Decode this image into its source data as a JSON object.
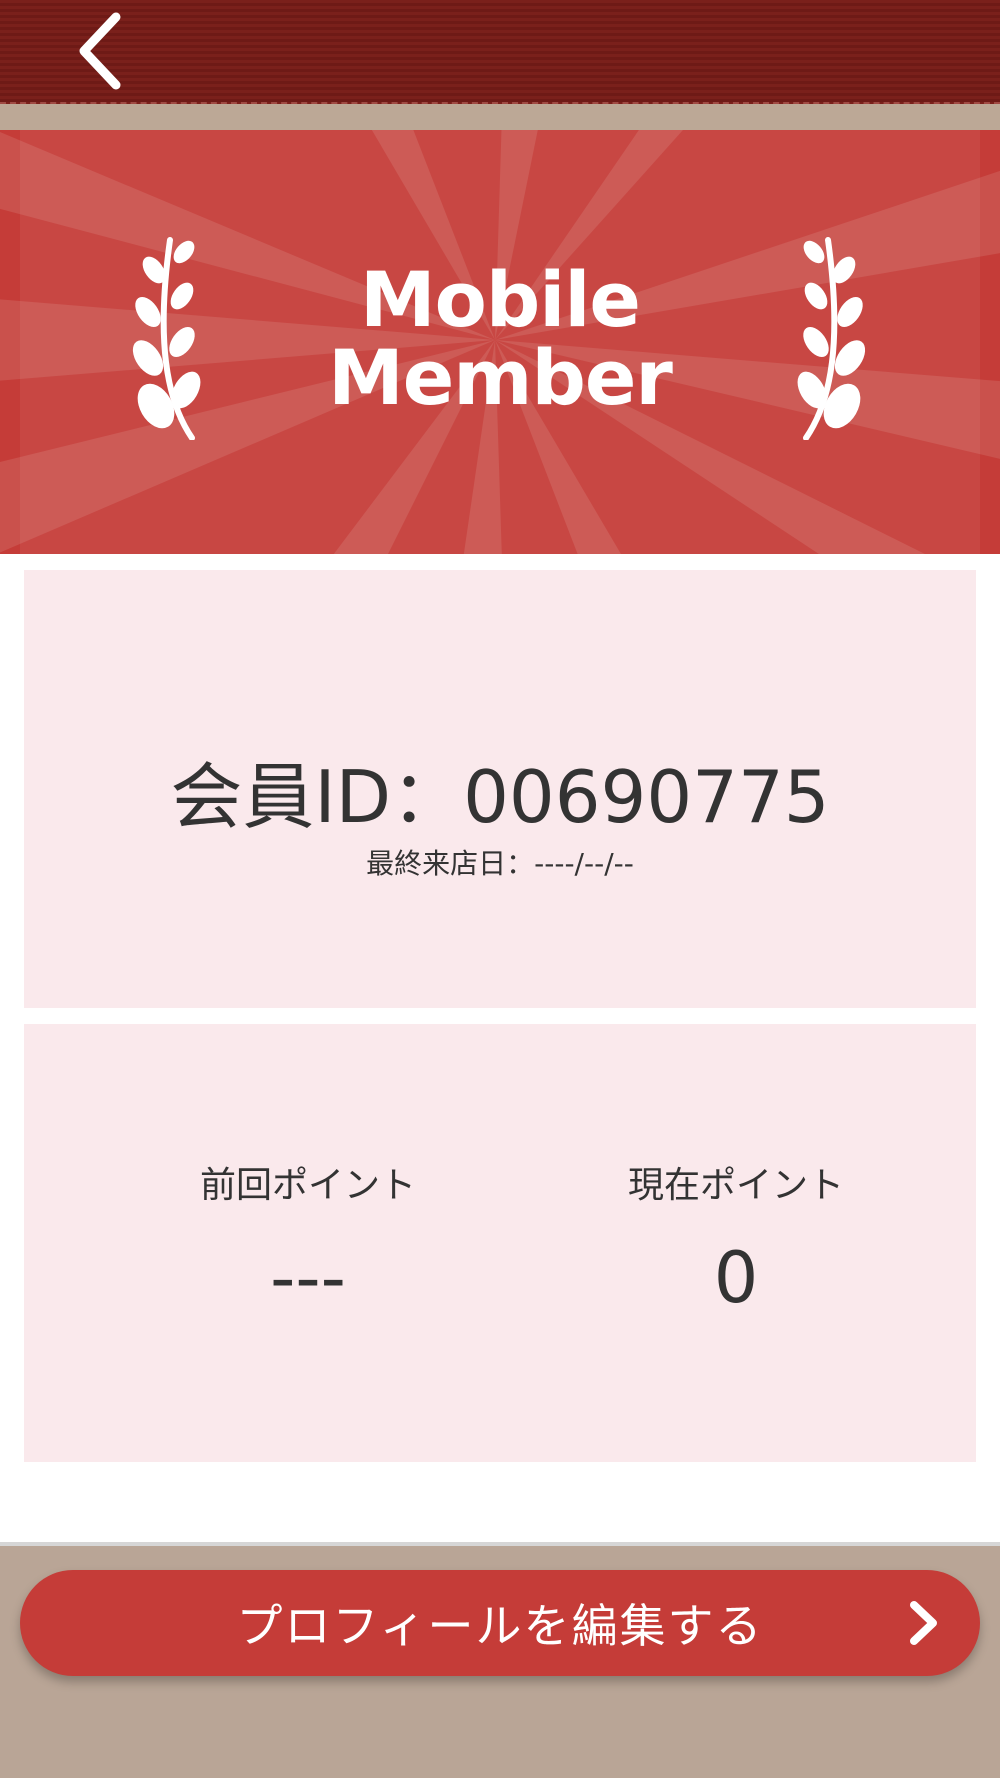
{
  "header": {
    "back_icon": "chevron-left-icon"
  },
  "hero": {
    "title_line1": "Mobile",
    "title_line2": "Member",
    "laurel_icon": "laurel-icon"
  },
  "member": {
    "id_text": "会員ID：00690775",
    "last_visit_text": "最終来店日：----/--/--"
  },
  "points": {
    "previous_label": "前回ポイント",
    "previous_value": "---",
    "current_label": "現在ポイント",
    "current_value": "0"
  },
  "footer": {
    "edit_profile_label": "プロフィールを編集する",
    "edit_icon": "chevron-right-icon"
  },
  "colors": {
    "accent": "#c53c38",
    "header": "#74201b",
    "card_bg": "#fae9ec",
    "page_bg": "#b9a596"
  }
}
